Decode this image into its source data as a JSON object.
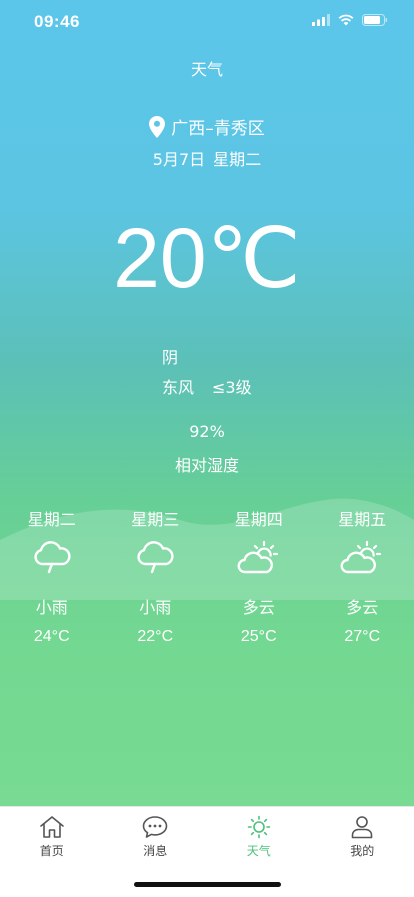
{
  "status_bar": {
    "time": "09:46"
  },
  "header": {
    "title": "天气"
  },
  "location": {
    "name": "广西–青秀区"
  },
  "date": {
    "day": "5月7日",
    "weekday": "星期二"
  },
  "current": {
    "temperature": "20℃",
    "condition": "阴",
    "wind_direction": "东风",
    "wind_level": "≤3级",
    "humidity_value": "92%",
    "humidity_label": "相对湿度"
  },
  "forecast": [
    {
      "weekday": "星期二",
      "icon": "rain-cloud-icon",
      "weather": "小雨",
      "temp": "24°C"
    },
    {
      "weekday": "星期三",
      "icon": "rain-cloud-icon",
      "weather": "小雨",
      "temp": "22°C"
    },
    {
      "weekday": "星期四",
      "icon": "partly-cloudy-icon",
      "weather": "多云",
      "temp": "25°C"
    },
    {
      "weekday": "星期五",
      "icon": "partly-cloudy-icon",
      "weather": "多云",
      "temp": "27°C"
    }
  ],
  "tabbar": {
    "items": [
      {
        "label": "首页",
        "icon": "home-icon"
      },
      {
        "label": "消息",
        "icon": "message-icon"
      },
      {
        "label": "天气",
        "icon": "sun-icon",
        "active": true
      },
      {
        "label": "我的",
        "icon": "user-icon"
      }
    ],
    "active_color": "#4cc17a"
  }
}
